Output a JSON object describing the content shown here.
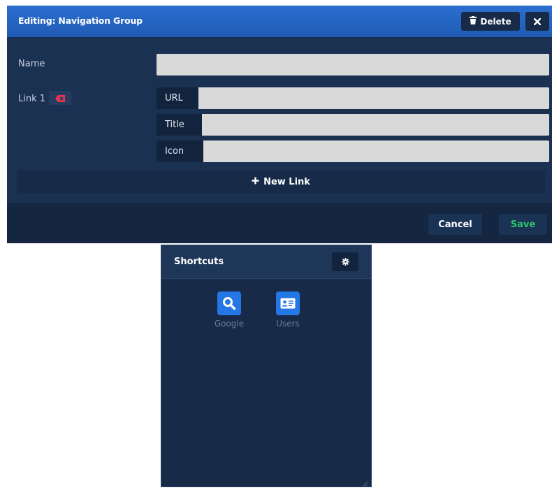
{
  "modal": {
    "title": "Editing: Navigation Group",
    "delete_label": "Delete",
    "fields": {
      "name_label": "Name",
      "name_value": "",
      "link1_label": "Link 1",
      "url_label": "URL",
      "url_value": "",
      "title_label": "Title",
      "title_value": "",
      "icon_label": "Icon",
      "icon_value": ""
    },
    "new_link_label": "New Link",
    "cancel_label": "Cancel",
    "save_label": "Save"
  },
  "widget": {
    "title": "Shortcuts",
    "shortcuts": [
      {
        "label": "Google",
        "icon": "search-icon"
      },
      {
        "label": "Users",
        "icon": "id-card-icon"
      }
    ]
  },
  "colors": {
    "header_blue": "#2b6fd0",
    "panel_navy": "#172a48",
    "save_green": "#2ec86f",
    "remove_red": "#e8344e",
    "shortcut_blue": "#2677e6"
  }
}
